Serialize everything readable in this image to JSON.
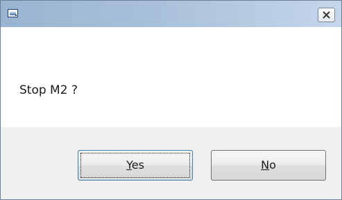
{
  "window": {
    "title": ""
  },
  "icons": {
    "app": "window-app-icon",
    "close": "close-icon"
  },
  "dialog": {
    "message": "Stop M2 ?"
  },
  "buttons": {
    "yes": {
      "accel": "Y",
      "rest": "es",
      "focused": true
    },
    "no": {
      "accel": "N",
      "rest": "o",
      "focused": false
    }
  },
  "colors": {
    "titlebar_start": "#99b4d1",
    "titlebar_end": "#c4d6ea",
    "button_bar": "#f0f0f0",
    "focus_border": "#3c7fb1"
  }
}
